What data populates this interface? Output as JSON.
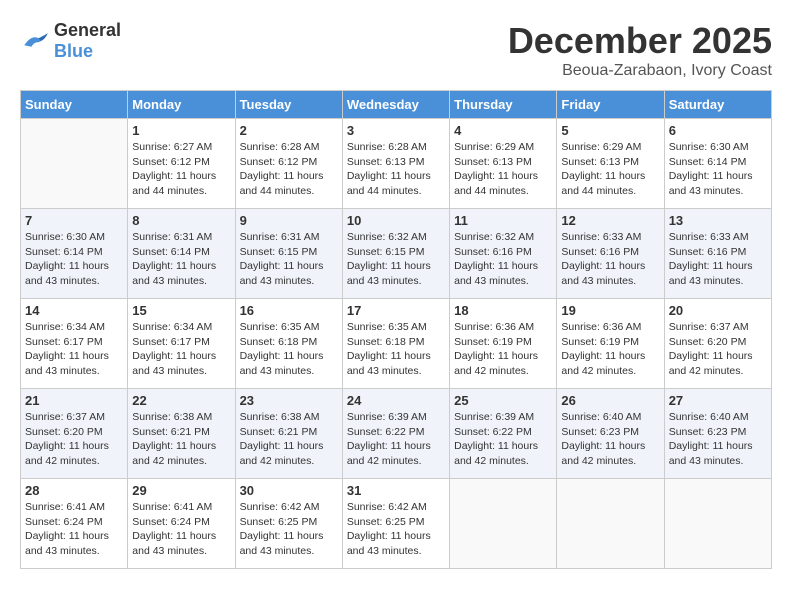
{
  "logo": {
    "text_general": "General",
    "text_blue": "Blue"
  },
  "title": "December 2025",
  "subtitle": "Beoua-Zarabaon, Ivory Coast",
  "days_of_week": [
    "Sunday",
    "Monday",
    "Tuesday",
    "Wednesday",
    "Thursday",
    "Friday",
    "Saturday"
  ],
  "weeks": [
    [
      {
        "day": "",
        "info": ""
      },
      {
        "day": "1",
        "info": "Sunrise: 6:27 AM\nSunset: 6:12 PM\nDaylight: 11 hours\nand 44 minutes."
      },
      {
        "day": "2",
        "info": "Sunrise: 6:28 AM\nSunset: 6:12 PM\nDaylight: 11 hours\nand 44 minutes."
      },
      {
        "day": "3",
        "info": "Sunrise: 6:28 AM\nSunset: 6:13 PM\nDaylight: 11 hours\nand 44 minutes."
      },
      {
        "day": "4",
        "info": "Sunrise: 6:29 AM\nSunset: 6:13 PM\nDaylight: 11 hours\nand 44 minutes."
      },
      {
        "day": "5",
        "info": "Sunrise: 6:29 AM\nSunset: 6:13 PM\nDaylight: 11 hours\nand 44 minutes."
      },
      {
        "day": "6",
        "info": "Sunrise: 6:30 AM\nSunset: 6:14 PM\nDaylight: 11 hours\nand 43 minutes."
      }
    ],
    [
      {
        "day": "7",
        "info": "Sunrise: 6:30 AM\nSunset: 6:14 PM\nDaylight: 11 hours\nand 43 minutes."
      },
      {
        "day": "8",
        "info": "Sunrise: 6:31 AM\nSunset: 6:14 PM\nDaylight: 11 hours\nand 43 minutes."
      },
      {
        "day": "9",
        "info": "Sunrise: 6:31 AM\nSunset: 6:15 PM\nDaylight: 11 hours\nand 43 minutes."
      },
      {
        "day": "10",
        "info": "Sunrise: 6:32 AM\nSunset: 6:15 PM\nDaylight: 11 hours\nand 43 minutes."
      },
      {
        "day": "11",
        "info": "Sunrise: 6:32 AM\nSunset: 6:16 PM\nDaylight: 11 hours\nand 43 minutes."
      },
      {
        "day": "12",
        "info": "Sunrise: 6:33 AM\nSunset: 6:16 PM\nDaylight: 11 hours\nand 43 minutes."
      },
      {
        "day": "13",
        "info": "Sunrise: 6:33 AM\nSunset: 6:16 PM\nDaylight: 11 hours\nand 43 minutes."
      }
    ],
    [
      {
        "day": "14",
        "info": "Sunrise: 6:34 AM\nSunset: 6:17 PM\nDaylight: 11 hours\nand 43 minutes."
      },
      {
        "day": "15",
        "info": "Sunrise: 6:34 AM\nSunset: 6:17 PM\nDaylight: 11 hours\nand 43 minutes."
      },
      {
        "day": "16",
        "info": "Sunrise: 6:35 AM\nSunset: 6:18 PM\nDaylight: 11 hours\nand 43 minutes."
      },
      {
        "day": "17",
        "info": "Sunrise: 6:35 AM\nSunset: 6:18 PM\nDaylight: 11 hours\nand 43 minutes."
      },
      {
        "day": "18",
        "info": "Sunrise: 6:36 AM\nSunset: 6:19 PM\nDaylight: 11 hours\nand 42 minutes."
      },
      {
        "day": "19",
        "info": "Sunrise: 6:36 AM\nSunset: 6:19 PM\nDaylight: 11 hours\nand 42 minutes."
      },
      {
        "day": "20",
        "info": "Sunrise: 6:37 AM\nSunset: 6:20 PM\nDaylight: 11 hours\nand 42 minutes."
      }
    ],
    [
      {
        "day": "21",
        "info": "Sunrise: 6:37 AM\nSunset: 6:20 PM\nDaylight: 11 hours\nand 42 minutes."
      },
      {
        "day": "22",
        "info": "Sunrise: 6:38 AM\nSunset: 6:21 PM\nDaylight: 11 hours\nand 42 minutes."
      },
      {
        "day": "23",
        "info": "Sunrise: 6:38 AM\nSunset: 6:21 PM\nDaylight: 11 hours\nand 42 minutes."
      },
      {
        "day": "24",
        "info": "Sunrise: 6:39 AM\nSunset: 6:22 PM\nDaylight: 11 hours\nand 42 minutes."
      },
      {
        "day": "25",
        "info": "Sunrise: 6:39 AM\nSunset: 6:22 PM\nDaylight: 11 hours\nand 42 minutes."
      },
      {
        "day": "26",
        "info": "Sunrise: 6:40 AM\nSunset: 6:23 PM\nDaylight: 11 hours\nand 42 minutes."
      },
      {
        "day": "27",
        "info": "Sunrise: 6:40 AM\nSunset: 6:23 PM\nDaylight: 11 hours\nand 43 minutes."
      }
    ],
    [
      {
        "day": "28",
        "info": "Sunrise: 6:41 AM\nSunset: 6:24 PM\nDaylight: 11 hours\nand 43 minutes."
      },
      {
        "day": "29",
        "info": "Sunrise: 6:41 AM\nSunset: 6:24 PM\nDaylight: 11 hours\nand 43 minutes."
      },
      {
        "day": "30",
        "info": "Sunrise: 6:42 AM\nSunset: 6:25 PM\nDaylight: 11 hours\nand 43 minutes."
      },
      {
        "day": "31",
        "info": "Sunrise: 6:42 AM\nSunset: 6:25 PM\nDaylight: 11 hours\nand 43 minutes."
      },
      {
        "day": "",
        "info": ""
      },
      {
        "day": "",
        "info": ""
      },
      {
        "day": "",
        "info": ""
      }
    ]
  ]
}
